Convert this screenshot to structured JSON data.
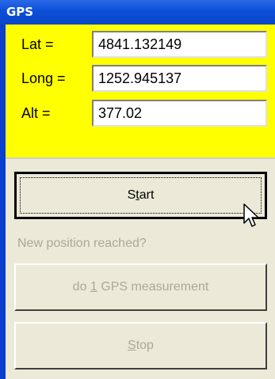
{
  "window": {
    "title": "GPS"
  },
  "coords": {
    "lat": {
      "label": "Lat =",
      "value": "4841.132149"
    },
    "long": {
      "label": "Long =",
      "value": "1252.945137"
    },
    "alt": {
      "label": "Alt =",
      "value": "377.02"
    }
  },
  "buttons": {
    "start": {
      "pre": "S",
      "accel": "t",
      "post": "art",
      "enabled": true
    },
    "measure": {
      "pre": "do ",
      "accel": "1",
      "post": " GPS measurement",
      "enabled": false
    },
    "stop": {
      "pre": "",
      "accel": "S",
      "post": "top",
      "enabled": false
    }
  },
  "status": {
    "prompt": "New position reached?"
  },
  "colors": {
    "title_bar": "#0a46c6",
    "coords_background": "#ffff00",
    "panel": "#ece9d8",
    "disabled_text": "#aca899"
  },
  "icons": {
    "cursor": "mouse-pointer-icon"
  }
}
